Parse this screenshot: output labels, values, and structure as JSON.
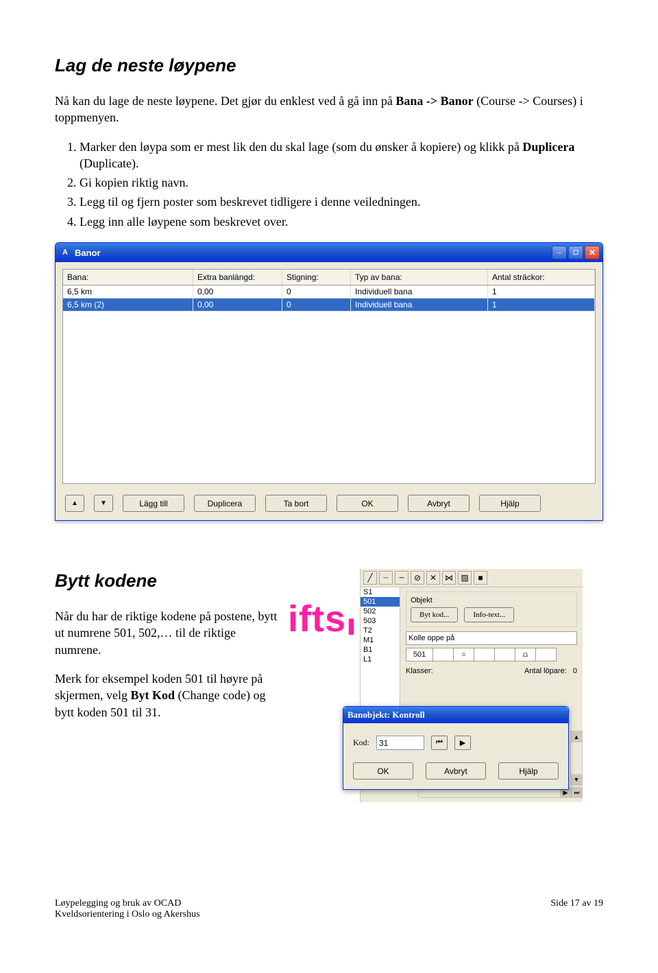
{
  "doc": {
    "section1_title": "Lag de neste løypene",
    "section1_intro_part1": "Nå kan du lage de neste løypene. Det gjør du enklest ved å gå inn på ",
    "section1_intro_bold1": "Bana -> Banor",
    "section1_intro_part2": " (Course -> Courses) i toppmenyen.",
    "steps": {
      "1_part_a": "Marker den løypa som er mest lik den du skal lage (som du ønsker å kopiere) og klikk på ",
      "1_bold": "Duplicera",
      "1_part_b": " (Duplicate).",
      "2": "Gi kopien riktig navn.",
      "3": "Legg til og fjern poster som beskrevet tidligere i denne veiledningen.",
      "4": "Legg inn alle løypene som beskrevet over."
    },
    "section2_title": "Bytt kodene",
    "section2_p1": "Når du har de riktige kodene på postene, bytt ut numrene 501, 502,… til de riktige numrene.",
    "section2_p2_a": "Merk for eksempel koden 501 til høyre på skjermen, velg ",
    "section2_p2_bold": "Byt Kod",
    "section2_p2_b": " (Change code) og bytt koden 501 til 31.",
    "footer_left1": "Løypelegging og bruk av OCAD",
    "footer_left2": "Kveldsorientering i Oslo og Akershus",
    "footer_right": "Side 17 av 19"
  },
  "banor": {
    "window_title": "Banor",
    "headers": [
      "Bana:",
      "Extra banlängd:",
      "Stigning:",
      "Typ av bana:",
      "Antal sträckor:"
    ],
    "rows": [
      {
        "bana": "6,5 km",
        "extra": "0,00",
        "stig": "0",
        "typ": "Individuell bana",
        "antal": "1",
        "selected": false
      },
      {
        "bana": "6,5 km  (2)",
        "extra": "0,00",
        "stig": "0",
        "typ": "Individuell bana",
        "antal": "1",
        "selected": true
      }
    ],
    "buttons": [
      "Lägg till",
      "Duplicera",
      "Ta bort",
      "OK",
      "Avbryt",
      "Hjälp"
    ]
  },
  "panel": {
    "objekt_label": "Objekt",
    "byt_kod": "Byt kod...",
    "info_text": "Info-text...",
    "desc_value": "Kolle oppe på",
    "code_value": "501",
    "klasser": "Klasser:",
    "antal": "Antal löpare:",
    "antal_value": "0",
    "obj_list": [
      "S1",
      "501",
      "502",
      "503",
      "T2",
      "M1",
      "B1",
      "L1"
    ],
    "obj_selected": "501",
    "tool_icons": [
      "line",
      "dotline",
      "dashline",
      "circ-cross",
      "cross",
      "dbl-cross",
      "diag",
      "sq"
    ]
  },
  "banobjekt": {
    "title": "Banobjekt: Kontroll",
    "kod_label": "Kod:",
    "kod_value": "31",
    "buttons": [
      "OK",
      "Avbryt",
      "Hjälp"
    ]
  },
  "iftsl_text": "iftsl"
}
